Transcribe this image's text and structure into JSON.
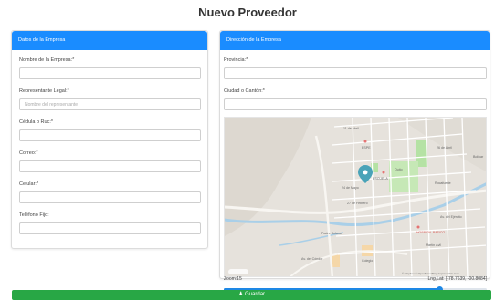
{
  "page": {
    "title": "Nuevo Proveedor"
  },
  "colors": {
    "primary": "#1a8cff",
    "success": "#28a745",
    "map_land": "#e8e4df",
    "map_park": "#b5e2a4",
    "map_river": "#a9cfe8"
  },
  "company": {
    "header": "Datos de la Empresa",
    "fields": [
      {
        "label": "Nombre de la Empresa:*",
        "value": "",
        "placeholder": ""
      },
      {
        "label": "Representante Legal:*",
        "value": "",
        "placeholder": "Nombre del representante"
      },
      {
        "label": "Cédula o Ruc:*",
        "value": "",
        "placeholder": ""
      },
      {
        "label": "Correo:*",
        "value": "",
        "placeholder": ""
      },
      {
        "label": "Celular:*",
        "value": "",
        "placeholder": ""
      },
      {
        "label": "Teléfono Fijo:",
        "value": "",
        "placeholder": ""
      }
    ]
  },
  "address": {
    "header": "Dirección de la Empresa",
    "fields": [
      {
        "label": "Provincia:*",
        "value": "",
        "placeholder": ""
      },
      {
        "label": "Ciudad o Cantón:*",
        "value": "",
        "placeholder": ""
      }
    ],
    "map": {
      "icon": "map-pin-icon",
      "attribution": "© Mapbox © OpenStreetMap Improve this map",
      "street_labels": [
        "11 de Abril",
        "ESPE",
        "26 de Abril",
        "Bolívar",
        "ESCUELA",
        "Quito",
        "24 de Mayo",
        "27 de Febrero",
        "Rocafuerte",
        "Juan Montalvo",
        "Av. del Ejército",
        "Padre Solano",
        "HOSPITAL BASICO",
        "Martín Ávil",
        "Av. del Cóndor",
        "Colegio"
      ]
    },
    "zoom_text": "Zoom:15",
    "coords_text": "Lng,Lat: [-78.7639, -00.8084]",
    "zoom_level": 0.82,
    "minus_label": "-",
    "plus_label": "+"
  },
  "submit": {
    "label": "Guardar",
    "icon": "user-plus-icon"
  }
}
